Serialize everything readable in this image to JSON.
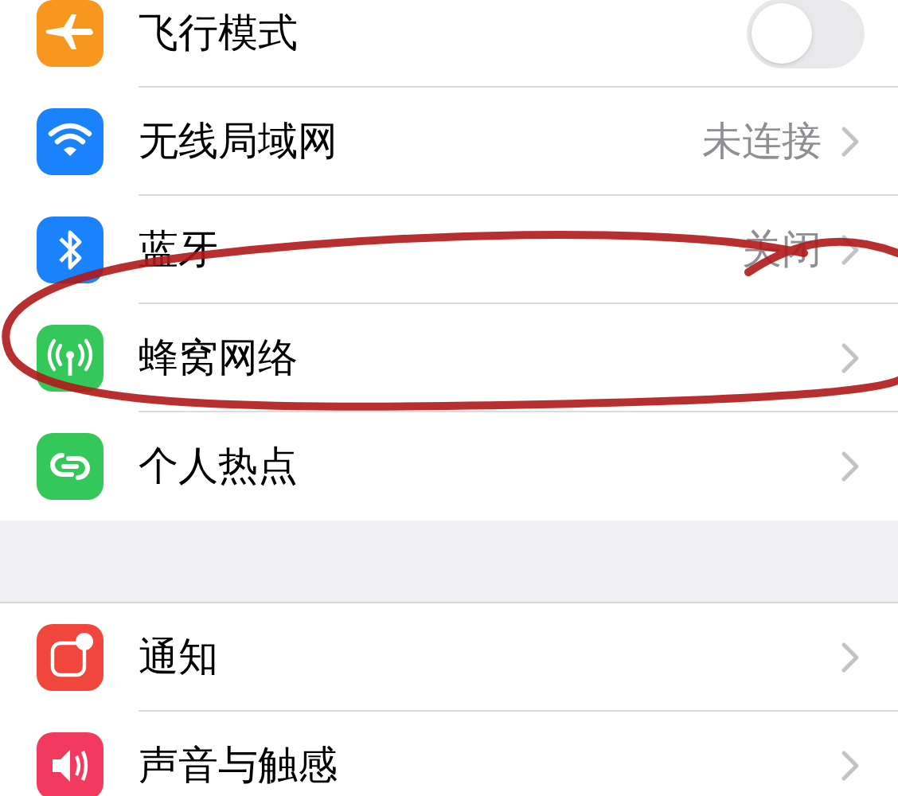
{
  "groups": [
    {
      "rows": [
        {
          "label": "飞行模式",
          "kind": "toggle",
          "on": false,
          "color": "#f7971e"
        },
        {
          "label": "无线局域网",
          "kind": "link",
          "value": "未连接",
          "color": "#1a82fb"
        },
        {
          "label": "蓝牙",
          "kind": "link",
          "value": "关闭",
          "color": "#1a82fb"
        },
        {
          "label": "蜂窝网络",
          "kind": "link",
          "color": "#34c759"
        },
        {
          "label": "个人热点",
          "kind": "link",
          "color": "#34c759"
        }
      ]
    },
    {
      "rows": [
        {
          "label": "通知",
          "kind": "link",
          "color": "#f0463c"
        },
        {
          "label": "声音与触感",
          "kind": "link",
          "color": "#f23a5e"
        }
      ]
    }
  ],
  "annotation": {
    "kind": "circle"
  }
}
